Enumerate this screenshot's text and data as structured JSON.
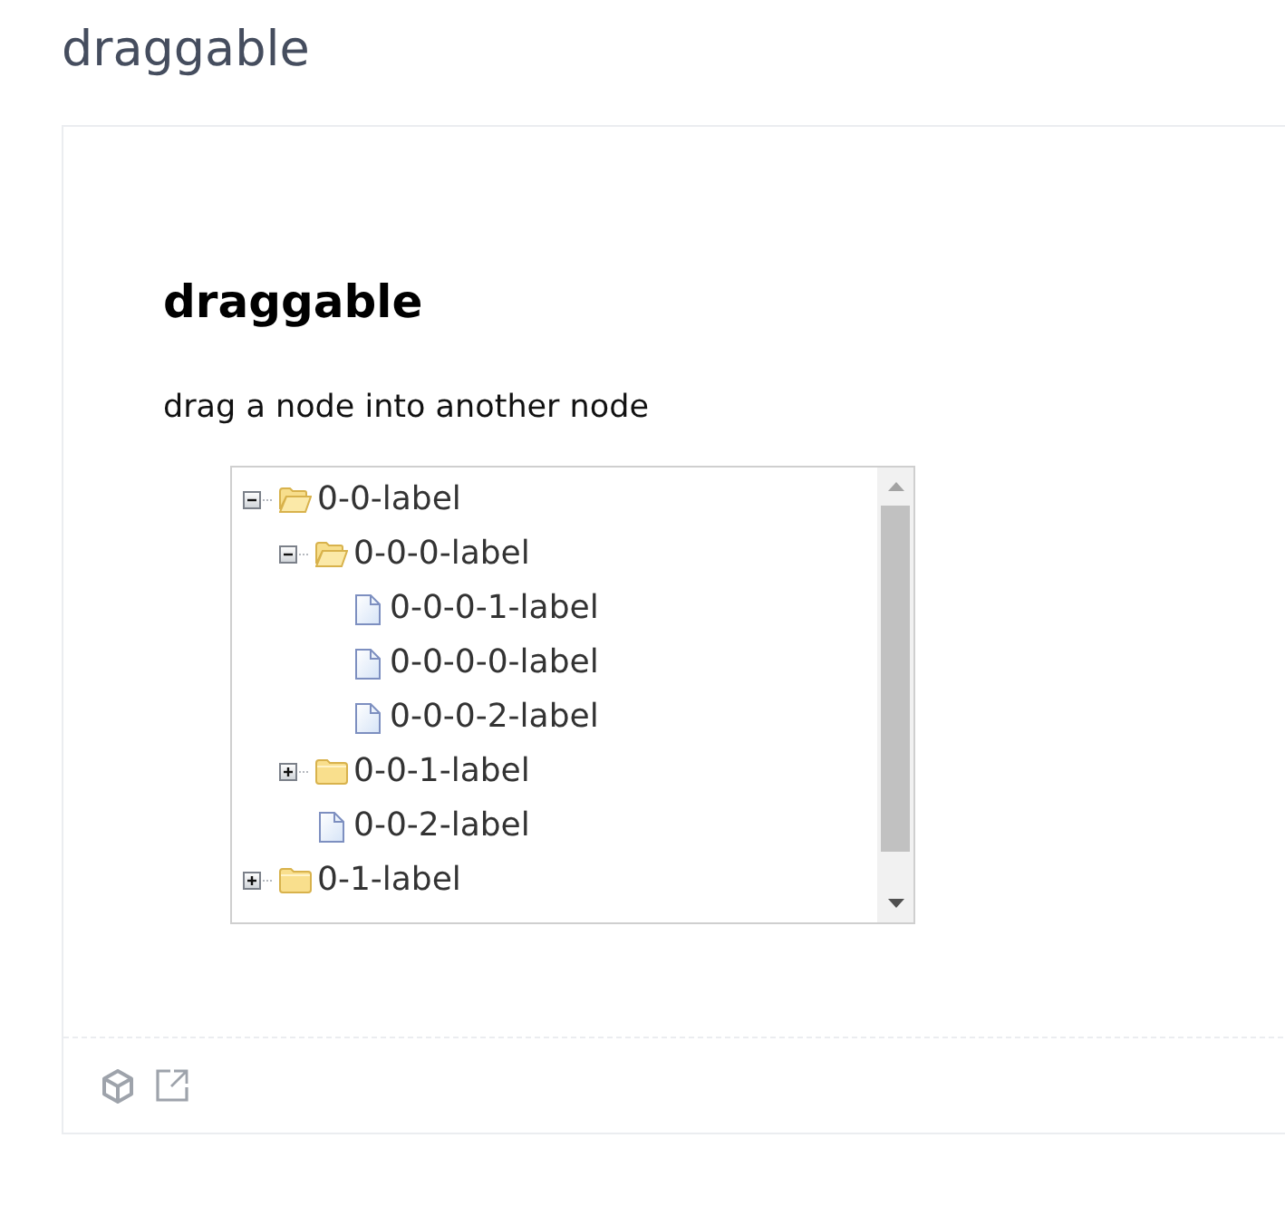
{
  "page_title": "draggable",
  "demo": {
    "title": "draggable",
    "description": "drag a node into another node",
    "tree": [
      {
        "label": "0-0-label",
        "kind": "folder",
        "expanded": true,
        "children": [
          {
            "label": "0-0-0-label",
            "kind": "folder",
            "expanded": true,
            "children": [
              {
                "label": "0-0-0-1-label",
                "kind": "file"
              },
              {
                "label": "0-0-0-0-label",
                "kind": "file"
              },
              {
                "label": "0-0-0-2-label",
                "kind": "file"
              }
            ]
          },
          {
            "label": "0-0-1-label",
            "kind": "folder",
            "expanded": false
          },
          {
            "label": "0-0-2-label",
            "kind": "file"
          }
        ]
      },
      {
        "label": "0-1-label",
        "kind": "folder",
        "expanded": false
      }
    ]
  }
}
